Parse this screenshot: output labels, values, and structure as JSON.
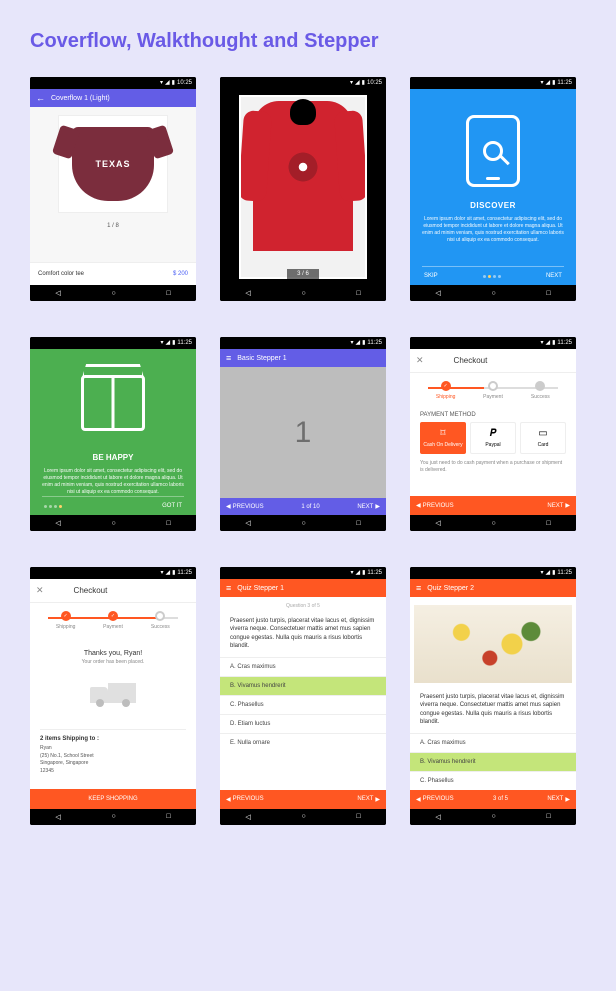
{
  "page_title": "Coverflow, Walkthought and Stepper",
  "status": {
    "time_1025": "10:25",
    "time_1125": "11:25"
  },
  "phone1": {
    "appbar": "Coverflow 1 (Light)",
    "tshirt_text": "TEXAS",
    "pager": "1 / 8",
    "product": "Comfort color tee",
    "price": "$ 200"
  },
  "phone2": {
    "pager": "3 / 6"
  },
  "phone3": {
    "title": "DISCOVER",
    "lorem": "Lorem ipsum dolor sit amet, consectetur adipiscing elit, sed do eiusmod tempor incididunt ut labore et dolore magna aliqua. Ut enim ad minim veniam, quis nostrud exercitation ullamco laboris nisi ut aliquip ex ea commodo consequat.",
    "skip": "SKIP",
    "next": "NEXT"
  },
  "phone4": {
    "title": "BE HAPPY",
    "lorem": "Lorem ipsum dolor sit amet, consectetur adipiscing elit, sed do eiusmod tempor incididunt ut labore et dolore magna aliqua. Ut enim ad minim veniam, quis nostrud exercitation ullamco laboris nisi ut aliquip ex ea commodo consequat.",
    "gotit": "GOT IT"
  },
  "phone5": {
    "appbar": "Basic Stepper 1",
    "number": "1",
    "prev": "PREVIOUS",
    "pager": "1 of 10",
    "next": "NEXT"
  },
  "phone6": {
    "title": "Checkout",
    "steps": {
      "s1": "Shipping",
      "s2": "Payment",
      "s3": "Success"
    },
    "section": "PAYMENT METHOD",
    "pay": {
      "p1": "Cash On Delivery",
      "p2": "Paypal",
      "p3": "Card"
    },
    "note": "You just need to do cash payment when a purchase or shipment is delivered.",
    "prev": "PREVIOUS",
    "next": "NEXT"
  },
  "phone7": {
    "title": "Checkout",
    "steps": {
      "s1": "Shipping",
      "s2": "Payment",
      "s3": "Success"
    },
    "thanks": "Thanks you, Ryan!",
    "placed": "Your order has been placed.",
    "ship_head": "2 items Shipping to :",
    "ship_name": "Ryan",
    "ship_addr1": "(25) No.1, School Street",
    "ship_addr2": "Singapore, Singapore",
    "ship_zip": "12345",
    "cta": "KEEP SHOPPING"
  },
  "phone8": {
    "appbar": "Quiz Stepper 1",
    "qlabel": "Question 3 of 5",
    "question": "Praesent justo turpis, placerat vitae lacus et, dignissim viverra neque. Consectetuer mattis amet mus sapien congue egestas. Nulla quis mauris a risus lobortis blandit.",
    "opts": {
      "a": "A. Cras maximus",
      "b": "B. Vivamus hendrerit",
      "c": "C. Phasellus",
      "d": "D. Etiam luctus",
      "e": "E. Nulla ornare"
    },
    "prev": "PREVIOUS",
    "next": "NEXT"
  },
  "phone9": {
    "appbar": "Quiz Stepper 2",
    "question": "Praesent justo turpis, placerat vitae lacus et, dignissim viverra neque. Consectetuer mattis amet mus sapien congue egestas. Nulla quis mauris a risus lobortis blandit.",
    "opts": {
      "a": "A. Cras maximus",
      "b": "B. Vivamus hendrerit",
      "c": "C. Phasellus"
    },
    "prev": "PREVIOUS",
    "pager": "3 of 5",
    "next": "NEXT"
  }
}
